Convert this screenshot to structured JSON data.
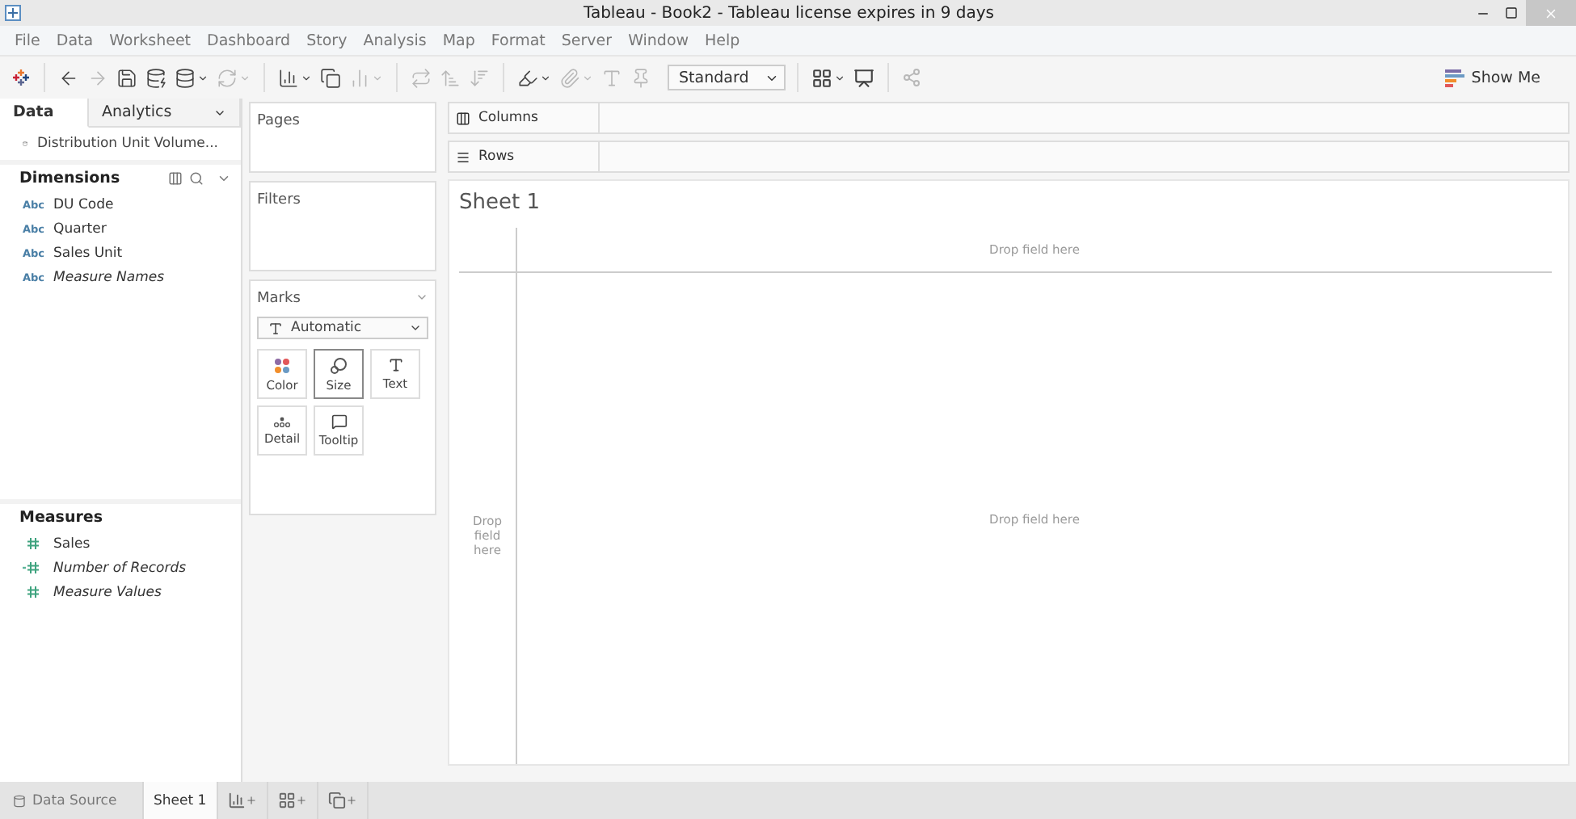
{
  "window": {
    "title": "Tableau - Book2 - Tableau license expires in 9 days"
  },
  "menu": [
    "File",
    "Data",
    "Worksheet",
    "Dashboard",
    "Story",
    "Analysis",
    "Map",
    "Format",
    "Server",
    "Window",
    "Help"
  ],
  "toolbar": {
    "tools": [
      {
        "disabled": false,
        "menu": false
      },
      {
        "disabled": true,
        "menu": false
      },
      {
        "disabled": false,
        "menu": false
      },
      {
        "disabled": false,
        "menu": false
      },
      {
        "disabled": false,
        "menu": true
      },
      {
        "disabled": true,
        "menu": true
      },
      {
        "disabled": false,
        "menu": true
      },
      {
        "disabled": false,
        "menu": false
      },
      {
        "disabled": true,
        "menu": true
      },
      {
        "disabled": true,
        "menu": false
      },
      {
        "disabled": true,
        "menu": false
      },
      {
        "disabled": true,
        "menu": false
      },
      {
        "disabled": false,
        "menu": true
      },
      {
        "disabled": true,
        "menu": true
      },
      {
        "disabled": true,
        "menu": false
      },
      {
        "disabled": true,
        "menu": false
      }
    ],
    "fit": "Standard",
    "show_me": "Show Me"
  },
  "data_pane": {
    "tabs": [
      {
        "label": "Data",
        "selected": true
      },
      {
        "label": "Analytics",
        "selected": false
      }
    ],
    "data_source": "Distribution Unit Volume...",
    "dimensions": {
      "title": "Dimensions",
      "fields": [
        {
          "type_label": "Abc",
          "name": "DU Code",
          "generated": false
        },
        {
          "type_label": "Abc",
          "name": "Quarter",
          "generated": false
        },
        {
          "type_label": "Abc",
          "name": "Sales Unit",
          "generated": false
        },
        {
          "type_label": "Abc",
          "name": "Measure Names",
          "generated": true
        }
      ]
    },
    "measures": {
      "title": "Measures",
      "fields": [
        {
          "name": "Sales",
          "generated": false,
          "calculated": false
        },
        {
          "name": "Number of Records",
          "generated": true,
          "calculated": true
        },
        {
          "name": "Measure Values",
          "generated": true,
          "calculated": false
        }
      ]
    }
  },
  "cards": {
    "pages": "Pages",
    "filters": "Filters",
    "marks": {
      "title": "Marks",
      "mark_type": "Automatic",
      "buttons": [
        {
          "kind": "color",
          "label": "Color",
          "selected": false
        },
        {
          "kind": "size",
          "label": "Size",
          "selected": true
        },
        {
          "kind": "text",
          "label": "Text",
          "selected": false
        },
        {
          "kind": "detail",
          "label": "Detail",
          "selected": false
        },
        {
          "kind": "tooltip",
          "label": "Tooltip",
          "selected": false
        }
      ]
    }
  },
  "shelves": [
    {
      "kind": "columns",
      "label": "Columns"
    },
    {
      "kind": "rows",
      "label": "Rows"
    }
  ],
  "sheet": {
    "title": "Sheet 1",
    "columns_hint": "Drop field here",
    "rows_hint": "Drop field here",
    "body_hint": "Drop field here"
  },
  "tabs": [
    {
      "kind": "data-source",
      "label": "Data Source",
      "selected": false
    },
    {
      "kind": "sheet",
      "label": "Sheet 1",
      "selected": true
    }
  ]
}
